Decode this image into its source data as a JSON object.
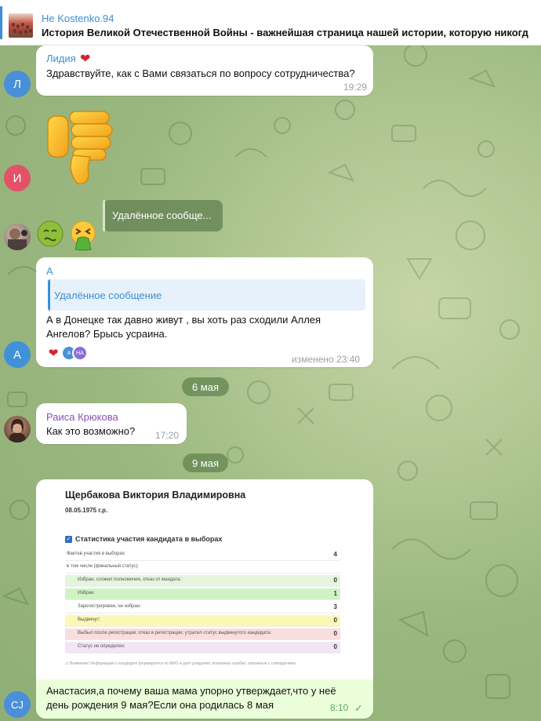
{
  "pinned": {
    "title": "Не Kostenko.94",
    "text": "История Великой Отечественной Войны - важнейшая страница нашей истории, которую никогд"
  },
  "messages": [
    {
      "avatar_letter": "Л",
      "avatar_color": "#4a8fd9",
      "sender": "Лидия",
      "sender_color": "#3a8fd6",
      "sender_emoji": "❤",
      "text": "Здравствуйте, как с Вами связаться по вопросу сотрудничества?",
      "time": "19:29"
    },
    {
      "avatar_letter": "И",
      "avatar_color": "#e35267",
      "sticker": "thumbs-down-sticker"
    },
    {
      "avatar": "photo",
      "emojis": [
        "nauseated-face-icon",
        "vomiting-face-icon"
      ],
      "reply_deleted": "Удалённое сообще..."
    },
    {
      "avatar_letter": "А",
      "avatar_color": "#3f92d9",
      "sender": "А",
      "sender_color": "#3a8fd6",
      "quote": "Удалённое сообщение",
      "text_lines": [
        "А в Донецке так давно живут , вы хоть раз сходили Аллея",
        "Ангелов? Брысь усраина."
      ],
      "reactions": [
        "❤",
        "А",
        "НА"
      ],
      "time": "изменено 23:40"
    },
    {
      "date": "6 мая"
    },
    {
      "avatar": "photo",
      "sender": "Раиса Крюкова",
      "sender_color": "#8e4fb8",
      "text": "Как это возможно?",
      "time": "17:20"
    },
    {
      "date": "9 мая"
    },
    {
      "avatar_letter": "СJ",
      "avatar_color": "#4a8fd9",
      "document": {
        "name": "Щербакова Виктория Владимировна",
        "dob": "08.05.1975 г.р.",
        "section": "Статистика участия кандидата в выборах",
        "rows": [
          {
            "label": "Фактов участия в выборах:",
            "value": "4",
            "bg": "#ffffff",
            "indent": false
          },
          {
            "label": "в том числе (финальный статус):",
            "value": "",
            "bg": "#ffffff",
            "indent": false
          },
          {
            "label": "Избран, сложил полномочия, отказ от мандата:",
            "value": "0",
            "bg": "#e3f5dd",
            "indent": true
          },
          {
            "label": "Избран:",
            "value": "1",
            "bg": "#cff3c4",
            "indent": true
          },
          {
            "label": "Зарегистрирован, не избран:",
            "value": "3",
            "bg": "#ffffff",
            "indent": true
          },
          {
            "label": "Выдвинут:",
            "value": "0",
            "bg": "#fbf8b4",
            "indent": true
          },
          {
            "label": "Выбыл после регистрации; отказ в регистрации; утратил статус выдвинутого кандидата:",
            "value": "0",
            "bg": "#f9dede",
            "indent": true
          },
          {
            "label": "Статус не определен:",
            "value": "0",
            "bg": "#f1e6f4",
            "indent": true
          }
        ],
        "note": "⚠ Внимание! Информация о кандидате формируется по ФИО и дате рождения, возможны ошибки, связанные с совпадением."
      },
      "text_lines": [
        "Анастасия,а почему ваша мама упорно утверждает,что у неё",
        "день рождения 9 мая?Если она родилась 8 мая"
      ],
      "time": "8:10"
    }
  ]
}
